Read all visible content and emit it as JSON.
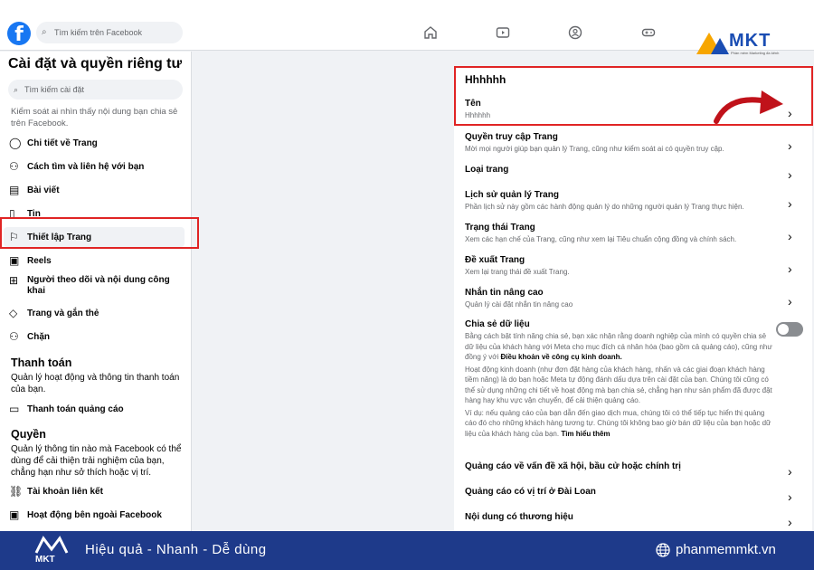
{
  "topbar": {
    "search_placeholder": "Tìm kiếm trên Facebook",
    "mkt_brand": "MKT",
    "mkt_tagline": "Phần mềm Marketing đa kênh"
  },
  "sidebar": {
    "title": "Cài đặt và quyền riêng tư",
    "search_placeholder": "Tìm kiếm cài đặt",
    "intro": "Kiểm soát ai nhìn thấy nội dung bạn chia sẻ trên Facebook.",
    "items": [
      {
        "label": "Chi tiết về Trang",
        "icon": "user-circle-icon"
      },
      {
        "label": "Cách tìm và liên hệ với bạn",
        "icon": "user-search-icon"
      },
      {
        "label": "Bài viết",
        "icon": "post-icon"
      },
      {
        "label": "Tin",
        "icon": "book-icon"
      },
      {
        "label": "Thiết lập Trang",
        "icon": "flag-icon"
      },
      {
        "label": "Reels",
        "icon": "reels-icon"
      },
      {
        "label": "Người theo dõi và nội dung công khai",
        "icon": "followers-icon"
      },
      {
        "label": "Trang và gắn thẻ",
        "icon": "tag-icon"
      },
      {
        "label": "Chặn",
        "icon": "block-user-icon"
      }
    ],
    "payments": {
      "heading": "Thanh toán",
      "desc": "Quản lý hoạt động và thông tin thanh toán của bạn.",
      "item": "Thanh toán quảng cáo"
    },
    "permissions": {
      "heading": "Quyền",
      "desc": "Quản lý thông tin nào mà Facebook có thể dùng để cải thiện trải nghiệm của bạn, chẳng hạn như sở thích hoặc vị trí.",
      "items": [
        "Tài khoản liên kết",
        "Hoạt động bên ngoài Facebook"
      ]
    }
  },
  "panel": {
    "title": "Hhhhhh",
    "rows": [
      {
        "label": "Tên",
        "sub": "Hhhhhh"
      },
      {
        "label": "Quyền truy cập Trang",
        "sub": "Mời mọi người giúp bạn quản lý Trang, cũng như kiểm soát ai có quyền truy cập."
      },
      {
        "label": "Loại trang",
        "sub": ""
      },
      {
        "label": "Lịch sử quản lý Trang",
        "sub": "Phần lịch sử này gồm các hành động quản lý do những người quản lý Trang thực hiện."
      },
      {
        "label": "Trạng thái Trang",
        "sub": "Xem các hạn chế của Trang, cũng như xem lại Tiêu chuẩn cộng đồng và chính sách."
      },
      {
        "label": "Đề xuất Trang",
        "sub": "Xem lại trang thái đề xuất Trang."
      },
      {
        "label": "Nhắn tin nâng cao",
        "sub": "Quản lý cài đặt nhắn tin nâng cao"
      }
    ],
    "data_sharing": {
      "label": "Chia sẻ dữ liệu",
      "p1_a": "Bằng cách bật tính năng chia sẻ, bạn xác nhận rằng doanh nghiệp của mình có quyền chia sẻ dữ liệu của khách hàng với Meta cho mục đích cá nhân hóa (bao gồm cả quảng cáo), cũng như đồng ý với ",
      "p1_link": "Điều khoản về công cụ kinh doanh.",
      "p2": "Hoạt động kinh doanh (như đơn đặt hàng của khách hàng, nhấn và các giai đoạn khách hàng tiềm năng) là do bạn hoặc Meta tự động đánh dấu dựa trên cài đặt của bạn. Chúng tôi cũng có thể sử dụng những chi tiết về hoạt động mà bạn chia sẻ, chẳng hạn như sản phẩm đã được đặt hàng hay khu vực vận chuyển, để cải thiện quảng cáo.",
      "p3_a": "Ví dụ: nếu quảng cáo của bạn dẫn đến giao dịch mua, chúng tôi có thể tiếp tục hiển thị quảng cáo đó cho những khách hàng tương tự. Chúng tôi không bao giờ bán dữ liệu của bạn hoặc dữ liệu của khách hàng của bạn. ",
      "p3_link": "Tìm hiểu thêm",
      "toggle_on": false
    },
    "bottom_rows": [
      {
        "label": "Quảng cáo về vấn đề xã hội, bầu cử hoặc chính trị"
      },
      {
        "label": "Quảng cáo có vị trí ở Đài Loan"
      },
      {
        "label": "Nội dung có thương hiệu"
      }
    ]
  },
  "banner": {
    "logo": "MKT",
    "slogan": "Hiệu quả - Nhanh - Dễ dùng",
    "site": "phanmemmkt.vn"
  },
  "colors": {
    "facebook_blue": "#1877f2",
    "highlight_red": "#e02424",
    "banner_blue": "#1e3a8a"
  }
}
